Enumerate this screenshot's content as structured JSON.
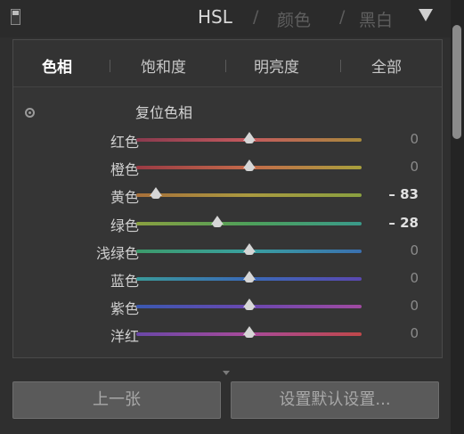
{
  "header": {
    "title": "HSL",
    "separator": "/",
    "tab_color": "颜色",
    "tab_bw": "黑白"
  },
  "tabs": [
    {
      "label": "色相",
      "active": true
    },
    {
      "label": "饱和度",
      "active": false
    },
    {
      "label": "明亮度",
      "active": false
    },
    {
      "label": "全部",
      "active": false
    }
  ],
  "reset_label": "复位色相",
  "sliders": [
    {
      "label": "红色",
      "value": "0",
      "value_num": 0,
      "colors": [
        "#8a3a4e",
        "#c45a5e",
        "#a88a3c"
      ]
    },
    {
      "label": "橙色",
      "value": "0",
      "value_num": 0,
      "colors": [
        "#9a3a44",
        "#c46a4a",
        "#a8a03c"
      ]
    },
    {
      "label": "黄色",
      "value": "– 83",
      "value_num": -83,
      "colors": [
        "#a8703a",
        "#aa9a40",
        "#8aa040"
      ]
    },
    {
      "label": "绿色",
      "value": "– 28",
      "value_num": -28,
      "colors": [
        "#8aa040",
        "#4ea05a",
        "#3a9a8a"
      ]
    },
    {
      "label": "浅绿色",
      "value": "0",
      "value_num": 0,
      "colors": [
        "#3c9a6a",
        "#3aa0a0",
        "#3a70b0"
      ]
    },
    {
      "label": "蓝色",
      "value": "0",
      "value_num": 0,
      "colors": [
        "#3a9a9a",
        "#3a6ab8",
        "#5a48b0"
      ]
    },
    {
      "label": "紫色",
      "value": "0",
      "value_num": 0,
      "colors": [
        "#3a58b0",
        "#6a48b0",
        "#a04aa0"
      ]
    },
    {
      "label": "洋红",
      "value": "0",
      "value_num": 0,
      "colors": [
        "#6a48a8",
        "#a84a9a",
        "#c0484a"
      ]
    }
  ],
  "buttons": {
    "previous": "上一张",
    "set_default": "设置默认设置..."
  }
}
